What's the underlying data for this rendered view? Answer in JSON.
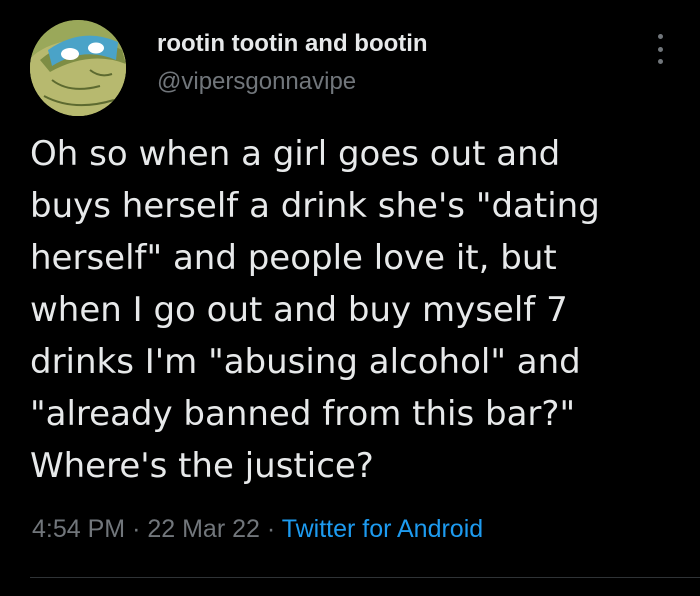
{
  "author": {
    "display_name": "rootin tootin and bootin",
    "handle": "@vipersgonnavipe",
    "avatar_icon": "turtle-avatar-icon"
  },
  "tweet": {
    "lines": [
      "Oh so when a girl goes out and",
      "buys herself a drink she's \"dating",
      "herself\" and people love it, but",
      "when I go out and buy myself 7",
      "drinks I'm \"abusing alcohol\" and",
      "\"already banned from this bar?\"",
      "Where's the justice?"
    ]
  },
  "meta": {
    "time": "4:54 PM",
    "separator": "·",
    "date": "22 Mar 22",
    "source": "Twitter for Android"
  },
  "colors": {
    "background": "#000000",
    "primary_text": "#e7e9ea",
    "secondary_text": "#71767b",
    "link": "#1d9bf0"
  },
  "icons": {
    "more_menu": "more-options-icon"
  }
}
